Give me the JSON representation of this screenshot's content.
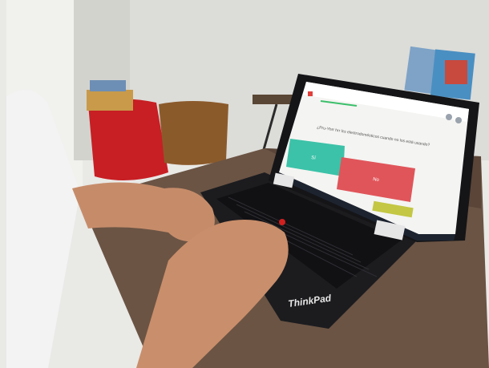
{
  "laptop": {
    "brand_label": "ThinkPad"
  },
  "screen": {
    "question_text": "¿Pru-Yhrr hrr lcs electrodomésticos cuando no los está usando?",
    "answer_yes_label": "Sí",
    "answer_no_label": "No",
    "colors": {
      "yes": "#3cc2a8",
      "no": "#e0555a",
      "header_accent": "#e0413c",
      "progress": "#3bbf6a"
    }
  }
}
